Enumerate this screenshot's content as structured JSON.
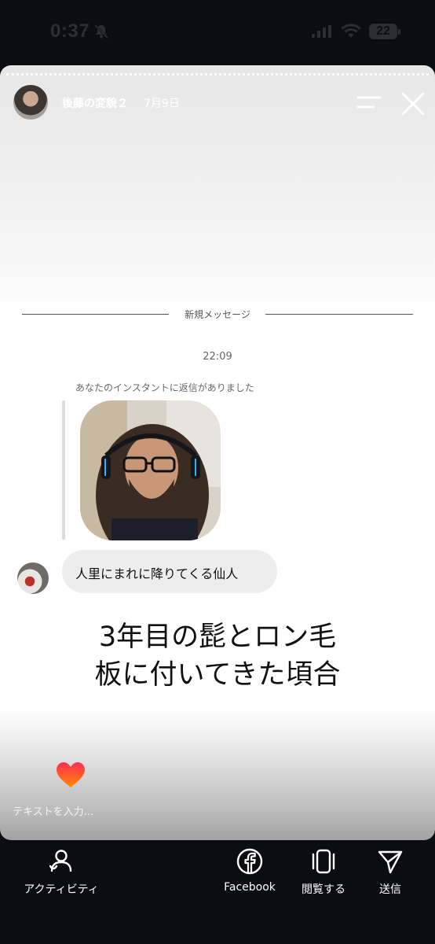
{
  "status_bar": {
    "time": "0:37",
    "battery": "22"
  },
  "story": {
    "username": "後藤の変貌２",
    "date": "7月9日"
  },
  "chat": {
    "divider_label": "新規メッセージ",
    "timestamp": "22:09",
    "reply_note": "あなたのインスタントに返信がありました",
    "message": "人里にまれに降りてくる仙人"
  },
  "caption": {
    "line1": "3年目の髭とロン毛",
    "line2": "板に付いてきた頃合"
  },
  "reply_input": {
    "placeholder": "テキストを入力..."
  },
  "bottom_bar": {
    "activity": "アクティビティ",
    "facebook": "Facebook",
    "view": "閲覧する",
    "send": "送信"
  },
  "colors": {
    "heart_top": "#ff2d55",
    "heart_bottom": "#ff8a00",
    "background": "#0c0d10"
  }
}
